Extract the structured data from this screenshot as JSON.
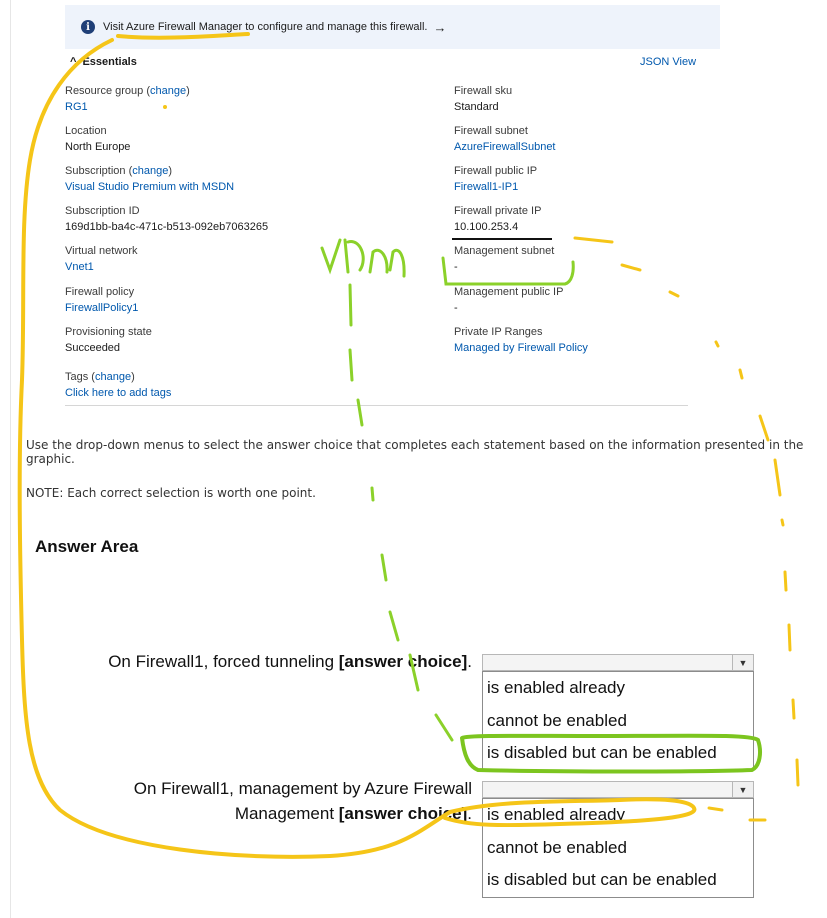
{
  "banner": {
    "text": "Visit Azure Firewall Manager to configure and manage this firewall.",
    "arrow": "→",
    "icon": "info-icon"
  },
  "essentials": {
    "label": "Essentials",
    "json_view": "JSON View"
  },
  "left_fields": [
    {
      "label": "Resource group",
      "change": "change",
      "value": "RG1"
    },
    {
      "label": "Location",
      "value": "North Europe"
    },
    {
      "label": "Subscription",
      "change": "change",
      "value": "Visual Studio Premium with MSDN"
    },
    {
      "label": "Subscription ID",
      "value": "169d1bb-ba4c-471c-b513-092eb7063265"
    },
    {
      "label": "Virtual network",
      "value": "Vnet1"
    },
    {
      "label": "Firewall policy",
      "value": "FirewallPolicy1"
    },
    {
      "label": "Provisioning state",
      "value": "Succeeded"
    },
    {
      "label": "Tags",
      "change": "change",
      "value": "Click here to add tags"
    }
  ],
  "right_fields": [
    {
      "label": "Firewall sku",
      "value": "Standard"
    },
    {
      "label": "Firewall subnet",
      "value": "AzureFirewallSubnet"
    },
    {
      "label": "Firewall public IP",
      "value": "Firewall1-IP1"
    },
    {
      "label": "Firewall private IP",
      "value": "10.100.253.4"
    },
    {
      "label": "Management subnet",
      "value": "-"
    },
    {
      "label": "Management public IP",
      "value": "-"
    },
    {
      "label": "Private IP Ranges",
      "value": "Managed by Firewall Policy"
    }
  ],
  "instructions": {
    "line1": "Use the drop-down menus to select the answer choice that completes each statement based on the information presented in the graphic.",
    "line2": "NOTE: Each correct selection is worth one point."
  },
  "answer_area": {
    "title": "Answer Area",
    "q1": {
      "text": "On Firewall1, forced tunneling ",
      "bold": "[answer choice]",
      "end": "."
    },
    "q2": {
      "line1": "On Firewall1, management by Azure Firewall",
      "line2": "Management ",
      "bold": "[answer choice]",
      "end": "."
    },
    "options": [
      "is enabled already",
      "cannot be enabled",
      "is disabled but can be enabled"
    ]
  },
  "handwriting": {
    "note": "vNn"
  },
  "colors": {
    "link": "#0058ad",
    "banner_bg": "#eef3fb",
    "highlight_yellow": "#f5c518",
    "highlight_green": "#7cc51f"
  }
}
